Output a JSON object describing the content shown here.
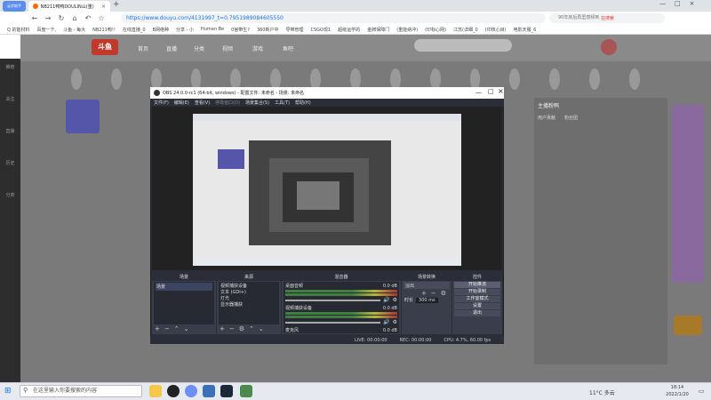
{
  "browser": {
    "profile": "云学助手",
    "tab_title": "NB211鸭鸭DOULIN山(重)",
    "url": "https://www.douyu.com/4131997_t=0.7951989084605550",
    "search_hint": "90年房后再里感频到",
    "search_btn": "在搜索",
    "bookmarks": [
      "Q 的能材料",
      "百度一下,",
      "斗鱼 - 每大",
      "NB211鸭!!",
      "在线直播_0",
      "B网络种",
      "分享 - 小",
      "Human Be",
      "0宫带生?",
      "360新户中",
      "导带管理",
      "CSGO现1",
      "超级运学的",
      "金牌保障门",
      "(重能纳冲)",
      "(印标心网)",
      "江苏(详细_0",
      "(印核心目)",
      "电影天服_6"
    ]
  },
  "site": {
    "logo": "斗鱼",
    "nav": [
      "首页",
      "直播",
      "分类",
      "视频",
      "游戏",
      "鱼吧"
    ],
    "chat_header": "主播粉鸭",
    "chat_tabs": [
      "用户贡献",
      "粉丝团"
    ],
    "leftbar": [
      "推荐",
      "关注",
      "直播",
      "历史",
      "分类"
    ]
  },
  "obs": {
    "title": "OBS 24.0.0-rc1 (64-bit, windows) - 配置文件: 未命名 - 场景: 未命名",
    "menu": [
      "文件(F)",
      "编辑(E)",
      "查看(V)",
      "停靠窗口(D)",
      "场景集合(S)",
      "工具(T)",
      "帮助(H)"
    ],
    "docks": {
      "scenes": {
        "title": "场景",
        "items": [
          "场景"
        ]
      },
      "sources": {
        "title": "来源",
        "items": [
          "视频捕获设备",
          "文本 (GDI+)",
          "灯光",
          "显示器捕获"
        ]
      },
      "mixer": {
        "title": "混音器",
        "tracks": [
          {
            "name": "桌面音频",
            "db": "0.0 dB"
          },
          {
            "name": "视频捕获设备",
            "db": "0.0 dB"
          },
          {
            "name": "麦克风",
            "db": "0.0 dB"
          }
        ]
      },
      "transitions": {
        "title": "场景转换",
        "type": "淡出",
        "duration_label": "时长",
        "duration": "300 ms"
      },
      "controls": {
        "title": "控件",
        "buttons": [
          "开始推流",
          "开始录制",
          "工作室模式",
          "设置",
          "退出"
        ]
      }
    },
    "status": {
      "live": "LIVE: 00:00:00",
      "rec": "REC: 00:00:00",
      "cpu": "CPU: 4.7%, 60.00 fps"
    }
  },
  "taskbar": {
    "search_placeholder": "在这里输入你要搜索的内容",
    "weather": "11°C 多云",
    "time": "18:14",
    "date": "2022/1/20"
  }
}
